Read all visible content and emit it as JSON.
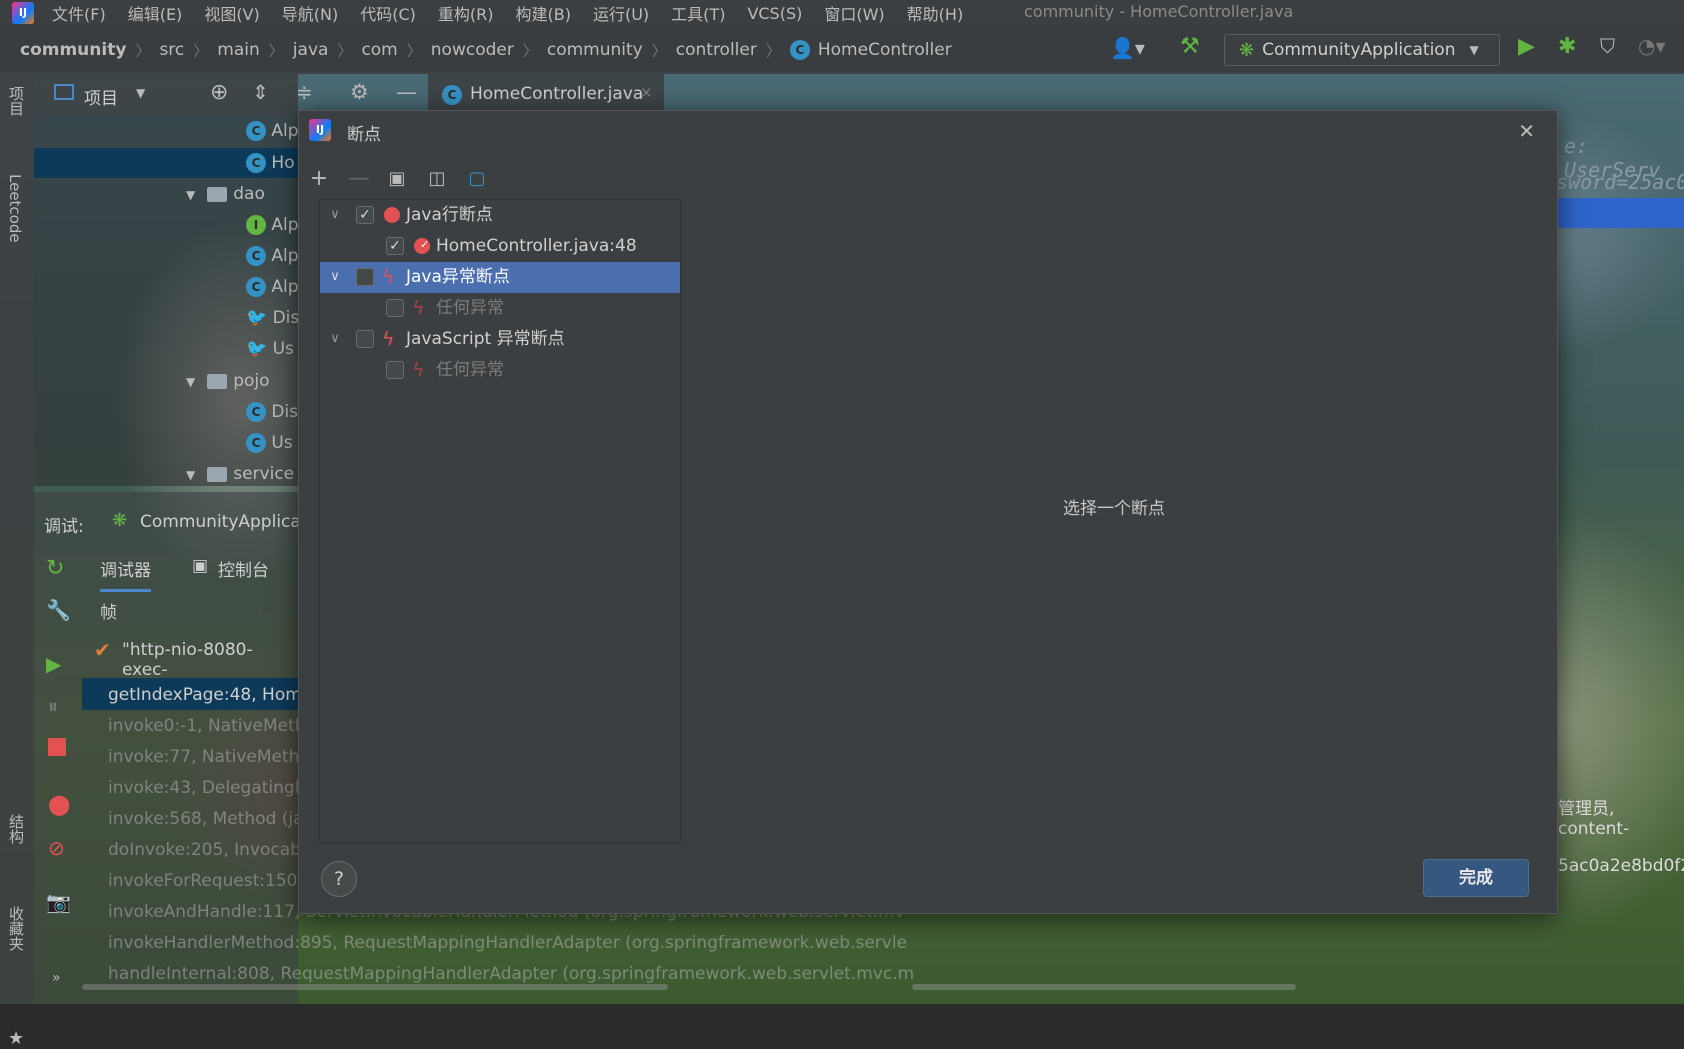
{
  "menubar": {
    "items": [
      "文件(F)",
      "编辑(E)",
      "视图(V)",
      "导航(N)",
      "代码(C)",
      "重构(R)",
      "构建(B)",
      "运行(U)",
      "工具(T)",
      "VCS(S)",
      "窗口(W)",
      "帮助(H)"
    ],
    "window_title": "community - HomeController.java"
  },
  "breadcrumb": [
    "community",
    "src",
    "main",
    "java",
    "com",
    "nowcoder",
    "community",
    "controller",
    "HomeController"
  ],
  "run_config": "CommunityApplication",
  "left_strip": {
    "project": "项目",
    "leetcode": "Leetcode",
    "structure": "结构",
    "favorites": "收藏夹"
  },
  "project_panel": {
    "title": "项目",
    "tree": [
      {
        "label": "Alp",
        "icon": "C"
      },
      {
        "label": "Ho",
        "icon": "C"
      },
      {
        "label": "dao",
        "icon": "folder"
      },
      {
        "label": "Alp",
        "icon": "I"
      },
      {
        "label": "Alp",
        "icon": "C"
      },
      {
        "label": "Alp",
        "icon": "C"
      },
      {
        "label": "Dis",
        "icon": "mapper"
      },
      {
        "label": "Us",
        "icon": "mapper"
      },
      {
        "label": "pojo",
        "icon": "folder"
      },
      {
        "label": "Dis",
        "icon": "C"
      },
      {
        "label": "Us",
        "icon": "C"
      },
      {
        "label": "service",
        "icon": "folder"
      }
    ]
  },
  "editor_tab": "HomeController.java",
  "editor_peek": [
    "e: UserServ",
    "sword=25ac0"
  ],
  "debug_panel": {
    "label": "调试:",
    "config": "CommunityApplica",
    "tab_debugger": "调试器",
    "tab_console": "控制台",
    "frames_header": "帧",
    "thread": "\"http-nio-8080-exec-",
    "frames": [
      "getIndexPage:48, Home",
      "invoke0:-1, NativeMeth",
      "invoke:77, NativeMetho",
      "invoke:43, DelegatingM",
      "invoke:568, Method (ja",
      "doInvoke:205, Invocabl",
      "invokeForRequest:150,",
      "invokeAndHandle:117, ServletInvocableHandlerMethod (org.springframework.web.servlet.mv",
      "invokeHandlerMethod:895, RequestMappingHandlerAdapter (org.springframework.web.servle",
      "handleInternal:808, RequestMappingHandlerAdapter (org.springframework.web.servlet.mvc.m"
    ]
  },
  "right_peek": [
    "管理员, content-",
    "5ac0a2e8bd0f2"
  ],
  "dialog": {
    "title": "断点",
    "tree": [
      {
        "label": "Java行断点",
        "checked": true,
        "level": 0,
        "icon": "dot",
        "expanded": true
      },
      {
        "label": "HomeController.java:48",
        "checked": true,
        "level": 1,
        "icon": "dot-check"
      },
      {
        "label": "Java异常断点",
        "checked": false,
        "level": 0,
        "icon": "bolt",
        "expanded": true,
        "selected": true
      },
      {
        "label": "任何异常",
        "checked": false,
        "level": 1,
        "icon": "bolt",
        "dim": true
      },
      {
        "label": "JavaScript 异常断点",
        "checked": false,
        "level": 0,
        "icon": "bolt",
        "expanded": true
      },
      {
        "label": "任何异常",
        "checked": false,
        "level": 1,
        "icon": "bolt",
        "dim": true
      }
    ],
    "placeholder": "选择一个断点",
    "done": "完成",
    "help": "?"
  }
}
